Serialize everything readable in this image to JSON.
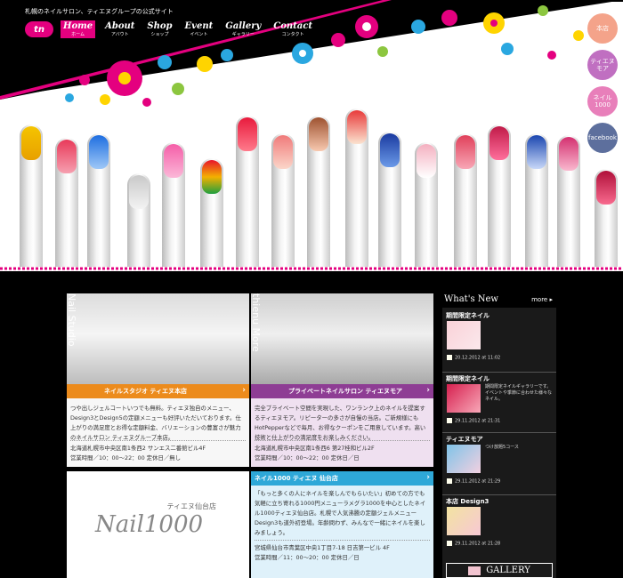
{
  "header": {
    "tagline": "札幌のネイルサロン、ティエヌグループの公式サイト",
    "logo": "tn",
    "nav": [
      {
        "en": "Home",
        "jp": "ホーム",
        "active": true
      },
      {
        "en": "About",
        "jp": "アバウト",
        "active": false
      },
      {
        "en": "Shop",
        "jp": "ショップ",
        "active": false
      },
      {
        "en": "Event",
        "jp": "イベント",
        "active": false
      },
      {
        "en": "Gallery",
        "jp": "ギャラリー",
        "active": false
      },
      {
        "en": "Contact",
        "jp": "コンタクト",
        "active": false
      }
    ],
    "side_buttons": [
      {
        "label": "本店",
        "color": "#f4a38a"
      },
      {
        "label": "ティエヌモア",
        "color": "#c06fc1"
      },
      {
        "label": "ネイル1000",
        "color": "#e87fba"
      },
      {
        "label": "facebook",
        "color": "#5d6f9d"
      }
    ]
  },
  "shops": {
    "honten": {
      "vertical": "Nail Studio",
      "banner": "ネイルスタジオ ティエヌ本店",
      "color": "#ec8b1c",
      "text": "つや出しジェルコートいつでも無料。ティエヌ独自のメニュー、Design3とDesign5の定額メニューも好評いただいております。仕上がりの満足度とお得な定額料金、バリエーションの豊富さが魅力のネイルサロン ティエヌグループ本店。",
      "address": "北海道札幌市中央区南1条西2 サンエス二番館ビル4F",
      "hours": "営業時間／10：00〜22：00 定休日／無し"
    },
    "more": {
      "vertical": "thienu More",
      "banner": "プライベートネイルサロン ティエヌモア",
      "color": "#8e3d94",
      "text": "完全プライベート空間を実現した、ワンランク上のネイルを提案するティエヌモア。リピーターの多さが自慢の当店。ご新規様にもHotPepperなどで毎月、お得なクーポンをご用意しています。高い技術と仕上がりの満足度をお楽しみください。",
      "address": "北海道札幌市中央区南1条西6 第27桂和ビル2F",
      "hours": "営業時間／10：00〜22：00 定休日／日"
    },
    "nail1000": {
      "logo_small": "ティエヌ仙台店",
      "logo_big": "Nail1000",
      "banner": "ネイル1000 ティエヌ 仙台店",
      "color": "#2ea8d8",
      "text": "「もっと多くの人にネイルを楽しんでもらいたい」初めての方でも気軽に立ち寄れる1000円メニューラメグラ1000を中心としたネイル1000ティエヌ仙台店。札幌で人気沸騰の定額ジェルメニューDesign3も道外初登場。年齢問わず、みんなで一緒にネイルを楽しみましょう。",
      "address": "宮城県仙台市青葉区中央1丁目7-18 日吉第一ビル 4F",
      "hours": "営業時間／11：00〜20：00 定休日／日"
    }
  },
  "whats_new": {
    "title": "What's New",
    "more": "more",
    "items": [
      {
        "category": "期間限定ネイル",
        "description": "",
        "date": "20.12.2012 at 11:02"
      },
      {
        "category": "期間限定ネイル",
        "description": "期間限定ネイルギャラリーです。イベントや季節に合わせた様々なネイル。",
        "date": "29.11.2012 at 21:31"
      },
      {
        "category": "ティエヌモア",
        "description": "つけ放題5コース",
        "date": "29.11.2012 at 21:29"
      },
      {
        "category": "本店 Design3",
        "description": "",
        "date": "29.11.2012 at 21:28"
      }
    ],
    "gallery": "GALLERY"
  }
}
